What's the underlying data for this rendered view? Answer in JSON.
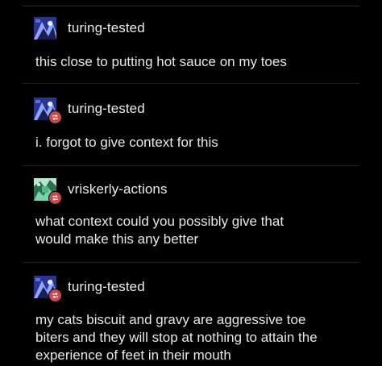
{
  "posts": [
    {
      "username": "turing-tested",
      "text_lines": [
        "this close to putting hot sauce on my toes"
      ],
      "reblog": false,
      "avatar_colors": [
        "#3a4bb0",
        "#8fa6ff",
        "#1a1f55",
        "#e8ecff"
      ]
    },
    {
      "username": "turing-tested",
      "text_lines": [
        "i. forgot to give context for this"
      ],
      "reblog": true,
      "avatar_colors": [
        "#3a4bb0",
        "#8fa6ff",
        "#1a1f55",
        "#e8ecff"
      ]
    },
    {
      "username": "vriskerly-actions",
      "text_lines": [
        "what context could you possibly give that",
        "would make this any better"
      ],
      "reblog": true,
      "avatar_colors": [
        "#4fb58a",
        "#b8e6c7",
        "#2d6e52",
        "#7ad3a6"
      ]
    },
    {
      "username": "turing-tested",
      "text_lines": [
        "my cats biscuit and gravy are aggressive toe",
        "biters and they will stop at nothing to attain the",
        "experience of feet in their mouth"
      ],
      "reblog": true,
      "avatar_colors": [
        "#3a4bb0",
        "#8fa6ff",
        "#1a1f55",
        "#e8ecff"
      ]
    }
  ],
  "colors": {
    "background": "#000000",
    "text": "#e8e8e8",
    "reblog_badge": "#c74a4f",
    "divider": "#1f1f1f"
  },
  "icons": {
    "reblog": "reblog-icon",
    "avatar": "avatar-icon"
  }
}
